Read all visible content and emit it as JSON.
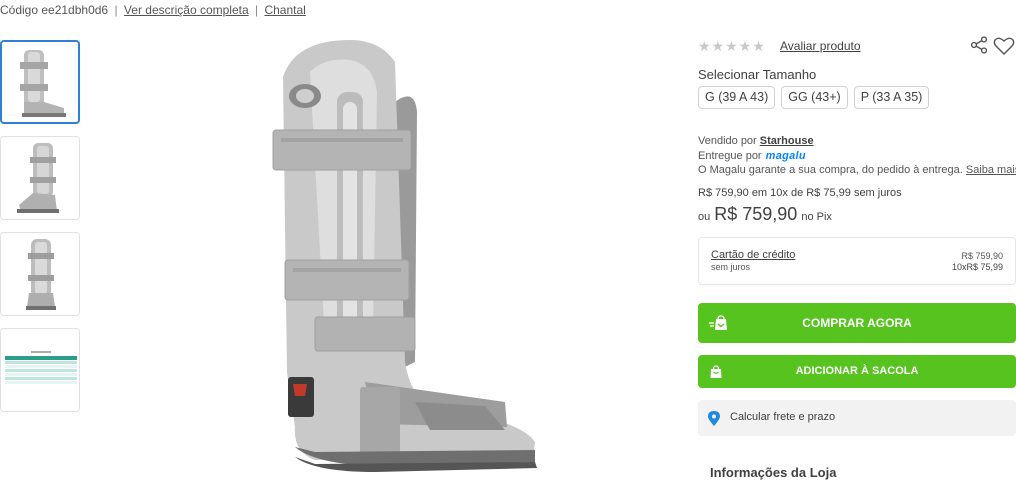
{
  "header": {
    "code_text": "Código ee21dbh0d6",
    "separator": "|",
    "full_description_link": "Ver descrição completa",
    "brand_link": "Chantal"
  },
  "thumbnails": [
    {
      "name": "thumb-boot-side",
      "active": true
    },
    {
      "name": "thumb-boot-angle",
      "active": false
    },
    {
      "name": "thumb-boot-front",
      "active": false
    },
    {
      "name": "thumb-size-table",
      "active": false
    }
  ],
  "rating": {
    "stars": "★★★★★",
    "rate_link": "Avaliar produto"
  },
  "size": {
    "title": "Selecionar Tamanho",
    "options": [
      "G (39 A 43)",
      "GG (43+)",
      "P (33 A 35)"
    ]
  },
  "seller": {
    "sold_by_label": "Vendido por",
    "seller_name": "Starhouse",
    "delivered_by_label": "Entregue por",
    "magalu_logo": "magalu",
    "guarantee_text": "O Magalu garante a sua compra, do pedido à entrega.",
    "learn_more_link": "Saiba mais"
  },
  "pricing": {
    "installments": "R$ 759,90 em 10x de R$ 75,99 sem juros",
    "or_label": "ou",
    "pix_price": "R$ 759,90",
    "pix_label": "no Pix"
  },
  "credit_card": {
    "title": "Cartão de crédito",
    "subtitle": "sem juros",
    "price": "R$ 759,90",
    "installments": "10xR$ 75,99"
  },
  "buttons": {
    "buy_now": "COMPRAR AGORA",
    "add_to_bag": "ADICIONAR À SACOLA"
  },
  "shipping": {
    "label": "Calcular frete e prazo"
  },
  "store_info": {
    "title": "Informações da Loja"
  },
  "colors": {
    "accent_green": "#56c31f",
    "magalu_blue": "#0086ff",
    "active_thumb_border": "#2f7fd8",
    "pin_blue": "#1f8be0"
  },
  "icons": {
    "share": "share-icon",
    "favorite": "heart-icon",
    "buy": "bag-arrow-icon",
    "bag": "bag-icon",
    "location": "map-pin-icon"
  }
}
